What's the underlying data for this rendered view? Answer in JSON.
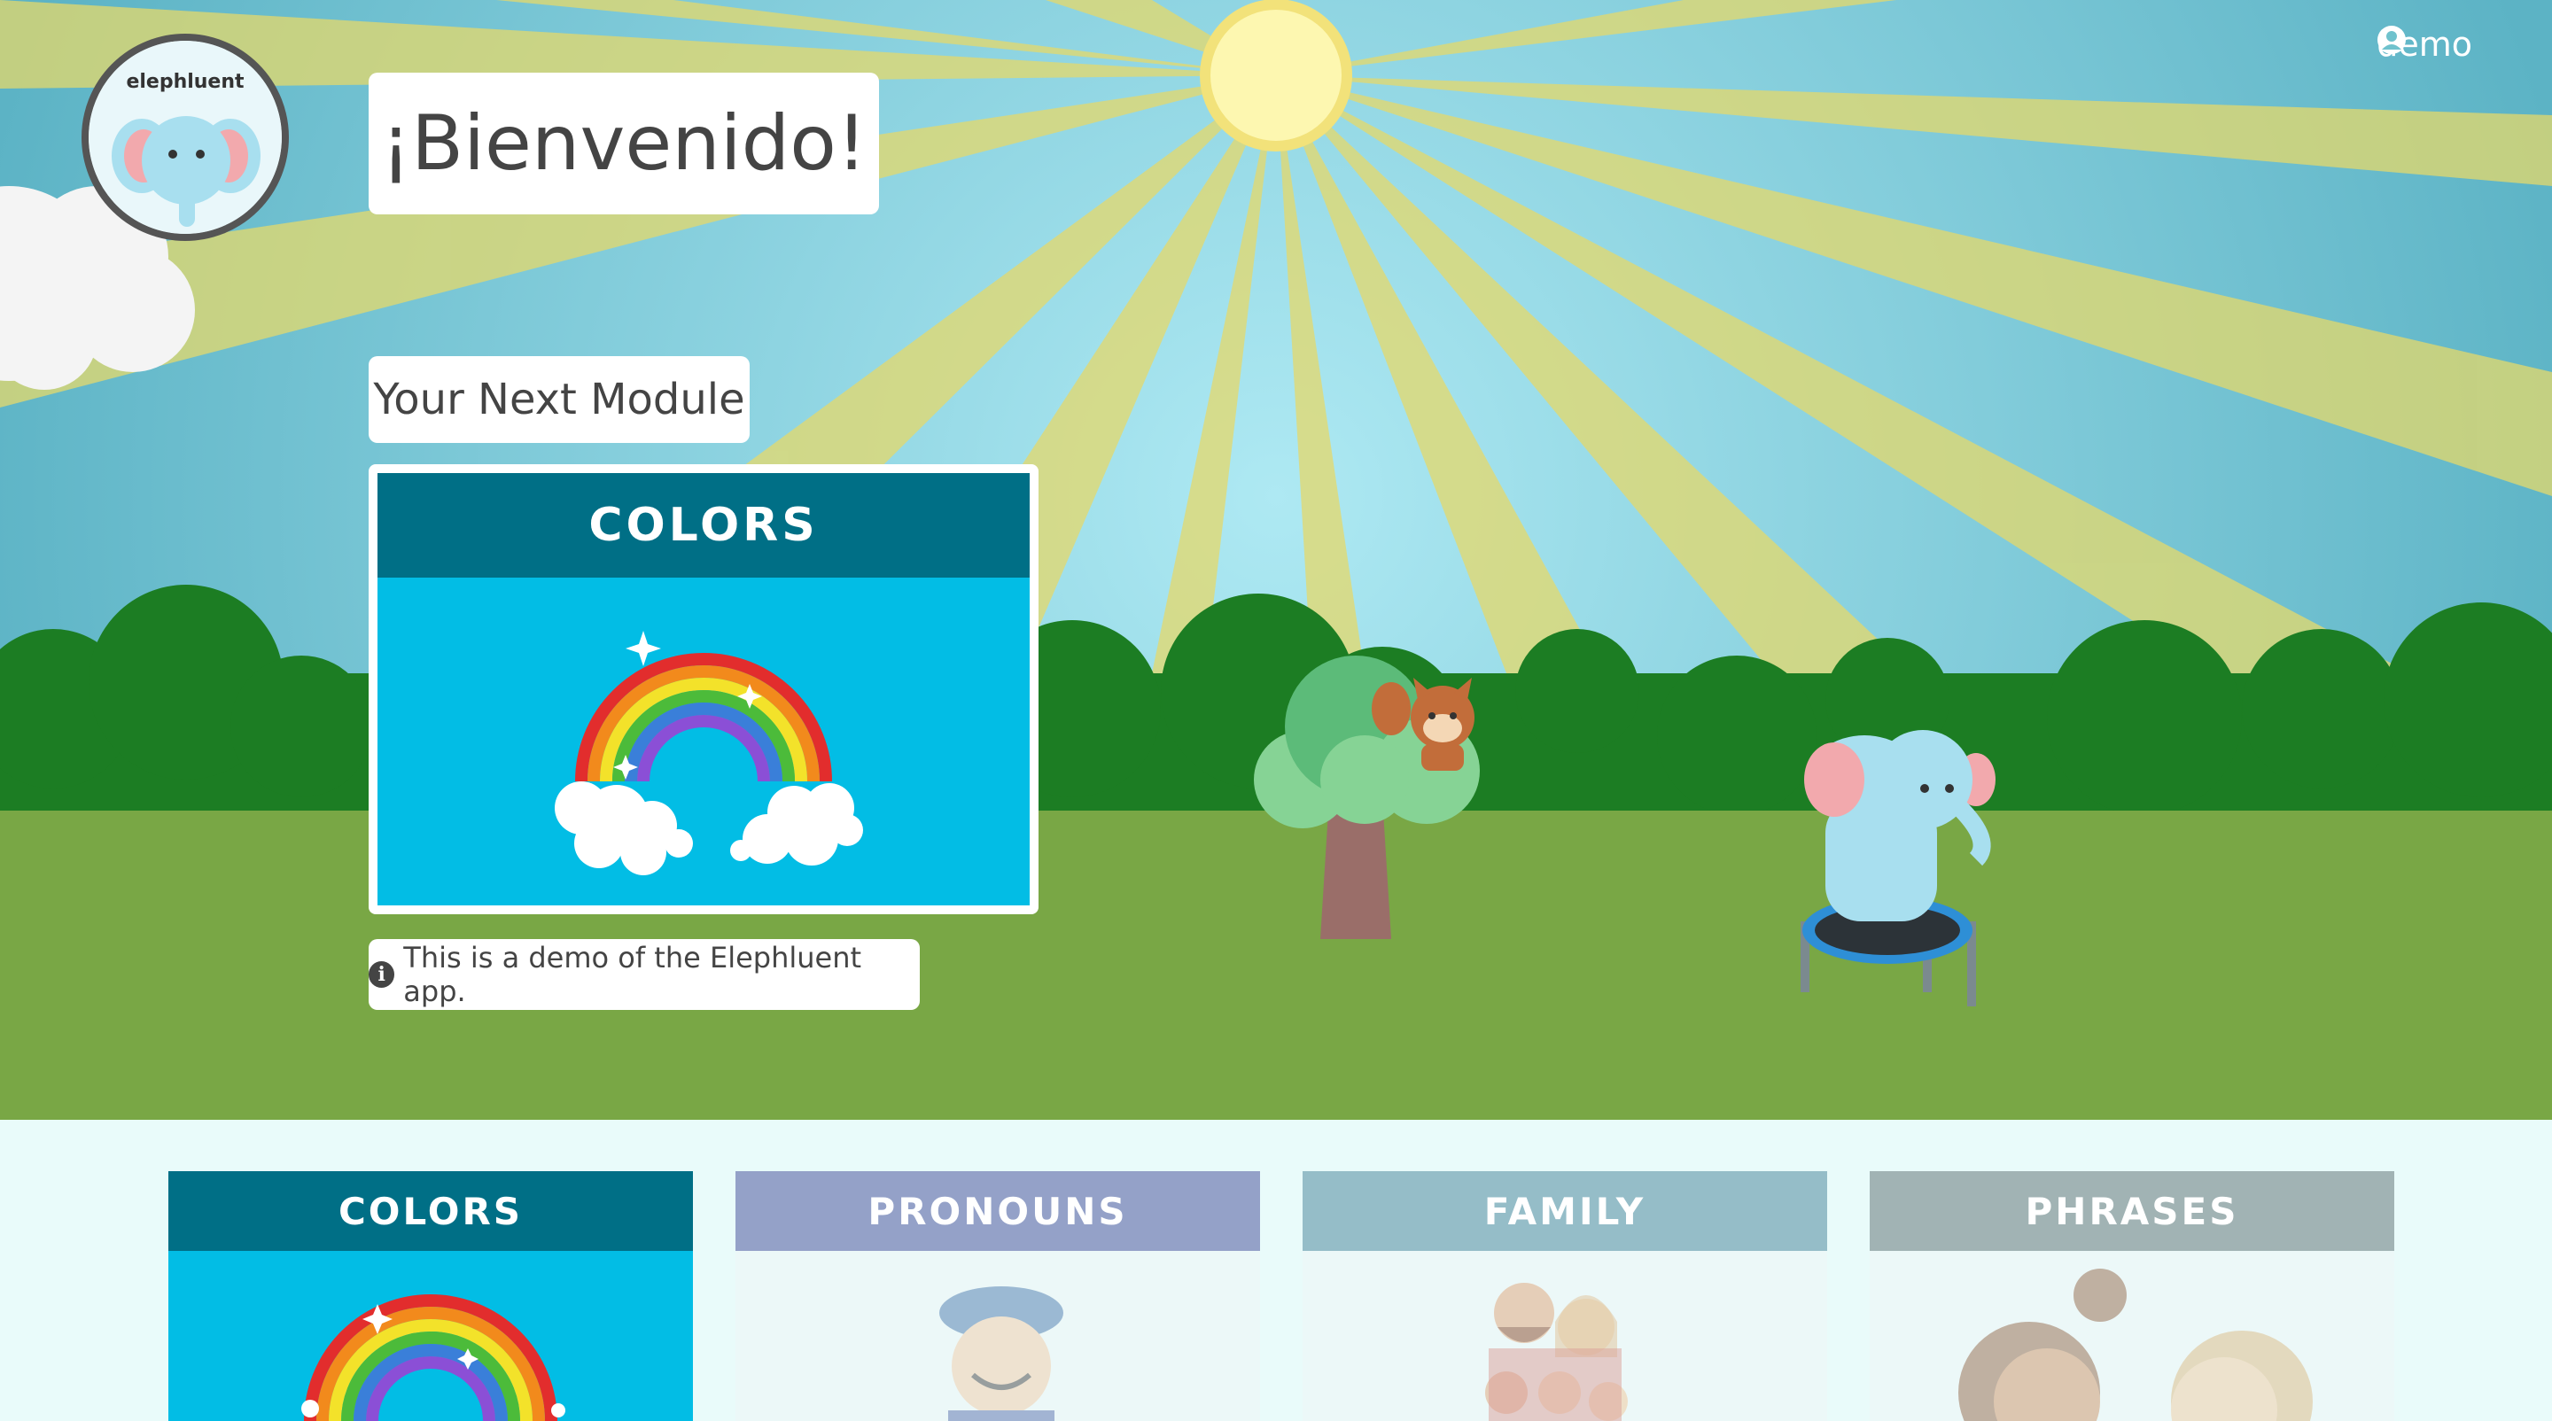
{
  "brand": {
    "name": "elephluent"
  },
  "user": {
    "name": "demo",
    "icon": "user-circle-icon"
  },
  "hero": {
    "greeting": "¡Bienvenido!",
    "next_module_label": "Your Next Module",
    "next_module": {
      "title": "COLORS"
    },
    "demo_note": "This is a demo of the Elephluent app.",
    "demo_note_icon": "info-icon"
  },
  "modules": [
    {
      "title": "COLORS",
      "active": true
    },
    {
      "title": "PRONOUNS",
      "active": false
    },
    {
      "title": "FAMILY",
      "active": false
    },
    {
      "title": "PHRASES",
      "active": false
    }
  ],
  "colors": {
    "sky": "#8fd6e0",
    "grass": "#79a745",
    "bushes": "#1c7d23",
    "module_header_active": "#006f86",
    "module_body_active": "#02bde5"
  }
}
